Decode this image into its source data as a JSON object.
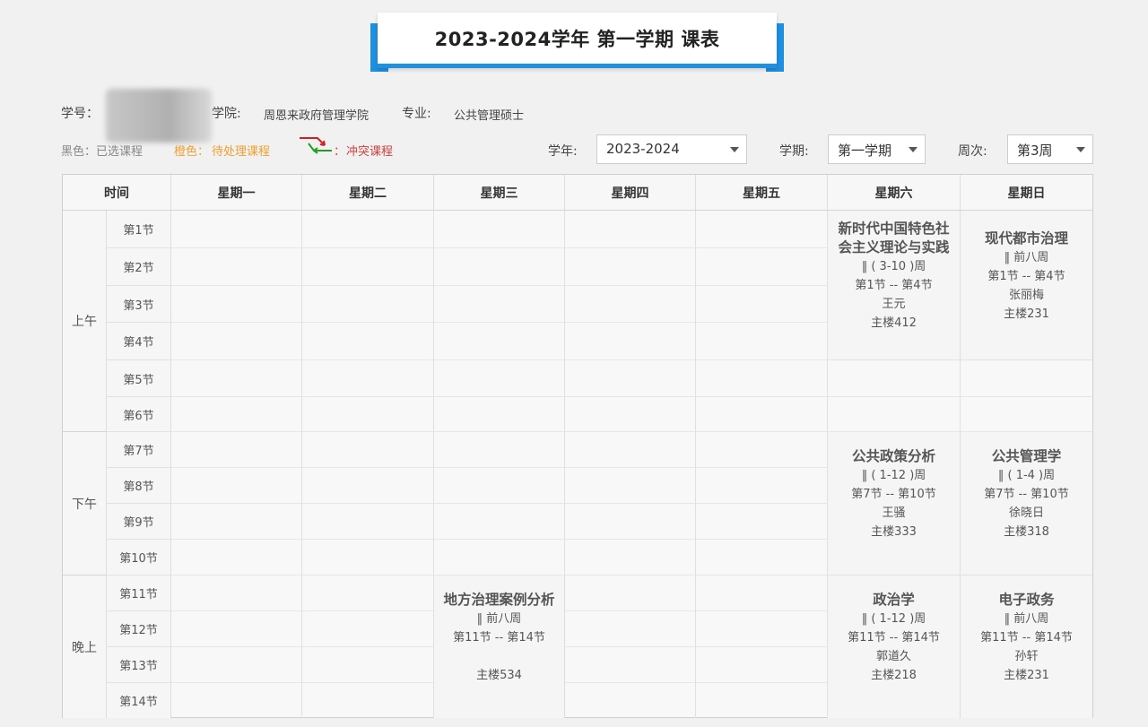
{
  "title": "2023-2024学年 第一学期 课表",
  "info": {
    "student_id_label": "学号：",
    "college_label": "学院:",
    "college_value": "周恩来政府管理学院",
    "major_label": "专业:",
    "major_value": "公共管理硕士"
  },
  "legend": {
    "black": "黑色：已选课程",
    "orange_prefix": "橙色：",
    "orange": "待处理课程",
    "conflict_prefix": "：",
    "conflict": "冲突课程",
    "colors": {
      "orange": "#f0a030",
      "conflict": "#d04040",
      "arrow_red": "#d02020",
      "arrow_green": "#20a020"
    }
  },
  "selectors": {
    "year_label": "学年:",
    "year_value": "2023-2024",
    "term_label": "学期:",
    "term_value": "第一学期",
    "week_label": "周次:",
    "week_value": "第3周"
  },
  "table": {
    "time_header": "时间",
    "days": [
      "星期一",
      "星期二",
      "星期三",
      "星期四",
      "星期五",
      "星期六",
      "星期日"
    ],
    "periods": [
      "上午",
      "下午",
      "晚上"
    ],
    "slots": [
      "第1节",
      "第2节",
      "第3节",
      "第4节",
      "第5节",
      "第6节",
      "第7节",
      "第8节",
      "第9节",
      "第10节",
      "第11节",
      "第12节",
      "第13节",
      "第14节"
    ]
  },
  "courses": [
    {
      "name": "新时代中国特色社会主义理论与实践",
      "weeks": "‖ ( 3-10 )周",
      "slots": "第1节 -- 第4节",
      "teacher": "王元",
      "room": "主楼412"
    },
    {
      "name": "现代都市治理",
      "weeks": "‖ 前八周",
      "slots": "第1节 -- 第4节",
      "teacher": "张丽梅",
      "room": "主楼231"
    },
    {
      "name": "公共政策分析",
      "weeks": "‖ ( 1-12 )周",
      "slots": "第7节 -- 第10节",
      "teacher": "王骚",
      "room": "主楼333"
    },
    {
      "name": "公共管理学",
      "weeks": "‖ ( 1-4 )周",
      "slots": "第7节 -- 第10节",
      "teacher": "徐晓日",
      "room": "主楼318"
    },
    {
      "name": "地方治理案例分析",
      "weeks": "‖ 前八周",
      "slots": "第11节 -- 第14节",
      "teacher": "",
      "room": "主楼534"
    },
    {
      "name": "政治学",
      "weeks": "‖ ( 1-12 )周",
      "slots": "第11节 -- 第14节",
      "teacher": "郭道久",
      "room": "主楼218"
    },
    {
      "name": "电子政务",
      "weeks": "‖ 前八周",
      "slots": "第11节 -- 第14节",
      "teacher": "孙轩",
      "room": "主楼231"
    }
  ]
}
